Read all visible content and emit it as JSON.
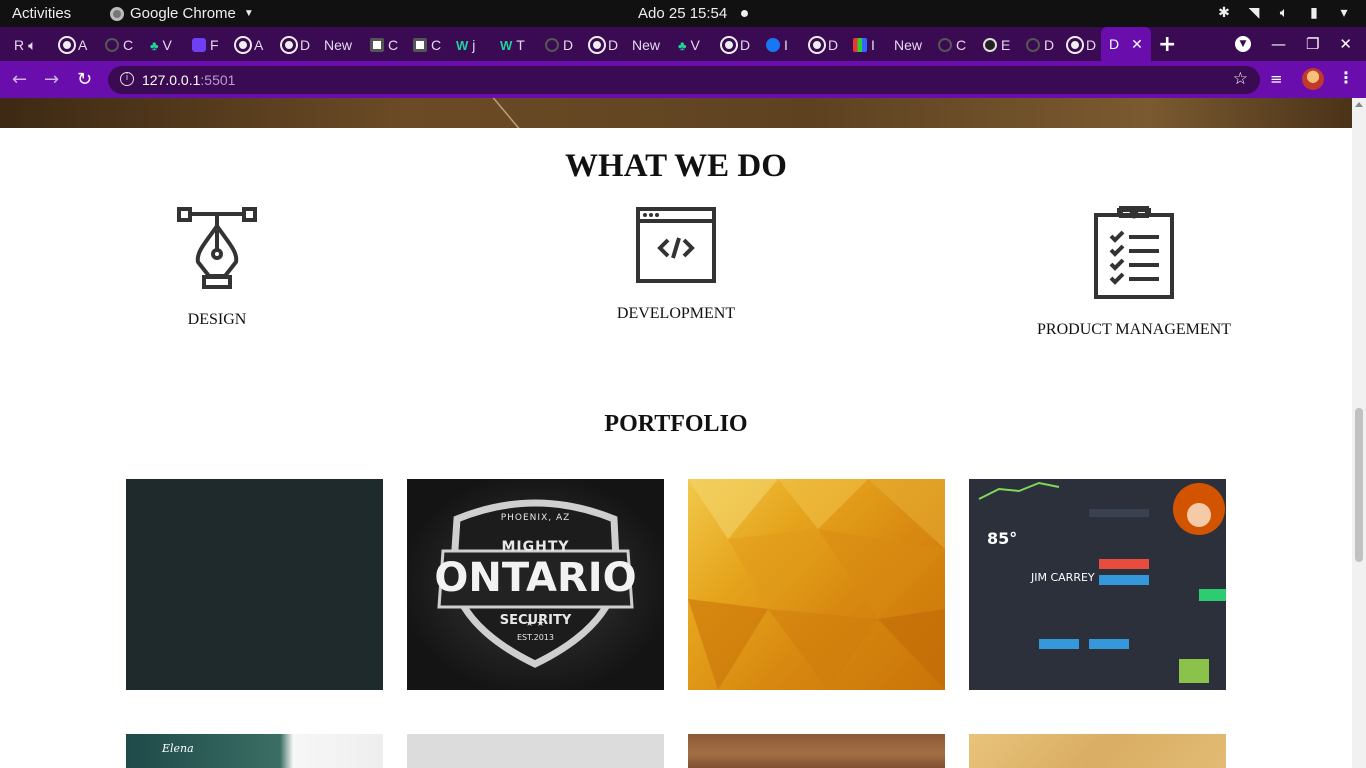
{
  "system_bar": {
    "activities": "Activities",
    "app_name": "Google Chrome",
    "clock": "Ado 25  15:54"
  },
  "tabs": [
    {
      "label": "R",
      "icon": "audio-icon"
    },
    {
      "label": "A",
      "icon": "globe-icon"
    },
    {
      "label": "C",
      "icon": "github-icon"
    },
    {
      "label": "V",
      "icon": "plant-icon"
    },
    {
      "label": "F",
      "icon": "bootstrap-icon"
    },
    {
      "label": "A",
      "icon": "globe-icon"
    },
    {
      "label": "D",
      "icon": "globe-icon"
    },
    {
      "label": "New",
      "icon": ""
    },
    {
      "label": "C",
      "icon": "codepen-icon"
    },
    {
      "label": "C",
      "icon": "codepen-icon"
    },
    {
      "label": "j",
      "icon": "w-icon"
    },
    {
      "label": "T",
      "icon": "w-icon"
    },
    {
      "label": "D",
      "icon": "github-icon"
    },
    {
      "label": "D",
      "icon": "globe-icon"
    },
    {
      "label": "New",
      "icon": ""
    },
    {
      "label": "V",
      "icon": "plant-icon"
    },
    {
      "label": "D",
      "icon": "globe-icon"
    },
    {
      "label": "I",
      "icon": "facebook-icon"
    },
    {
      "label": "D",
      "icon": "globe-icon"
    },
    {
      "label": "I",
      "icon": "multicolor-icon"
    },
    {
      "label": "New",
      "icon": ""
    },
    {
      "label": "C",
      "icon": "github-icon"
    },
    {
      "label": "E",
      "icon": "cap-icon"
    },
    {
      "label": "D",
      "icon": "github-icon"
    },
    {
      "label": "D",
      "icon": "globe-icon"
    },
    {
      "label": "D",
      "icon": "",
      "active": true
    }
  ],
  "address_bar": {
    "host": "127.0.0.1",
    "port": ":5501"
  },
  "page": {
    "what_we_do_title": "WHAT WE DO",
    "services": [
      {
        "label": "DESIGN",
        "icon": "pen-tool-icon"
      },
      {
        "label": "DEVELOPMENT",
        "icon": "code-window-icon"
      },
      {
        "label": "PRODUCT MANAGEMENT",
        "icon": "clipboard-checklist-icon"
      }
    ],
    "portfolio_title": "PORTFOLIO",
    "portfolio_items": [
      {
        "name": "dark-slate"
      },
      {
        "name": "mighty-ontario-security",
        "top": "PHOENIX, AZ",
        "line1": "MIGHTY",
        "line2": "ONTARIO",
        "line3": "SECURITY",
        "line4": "EST.2013"
      },
      {
        "name": "golden-polygon"
      },
      {
        "name": "dashboard-ui",
        "temp": "85°",
        "person": "JIM CARREY"
      },
      {
        "name": "elena-website",
        "label": "Elena"
      },
      {
        "name": "grey-mockup"
      },
      {
        "name": "wood"
      },
      {
        "name": "parchment"
      }
    ]
  }
}
